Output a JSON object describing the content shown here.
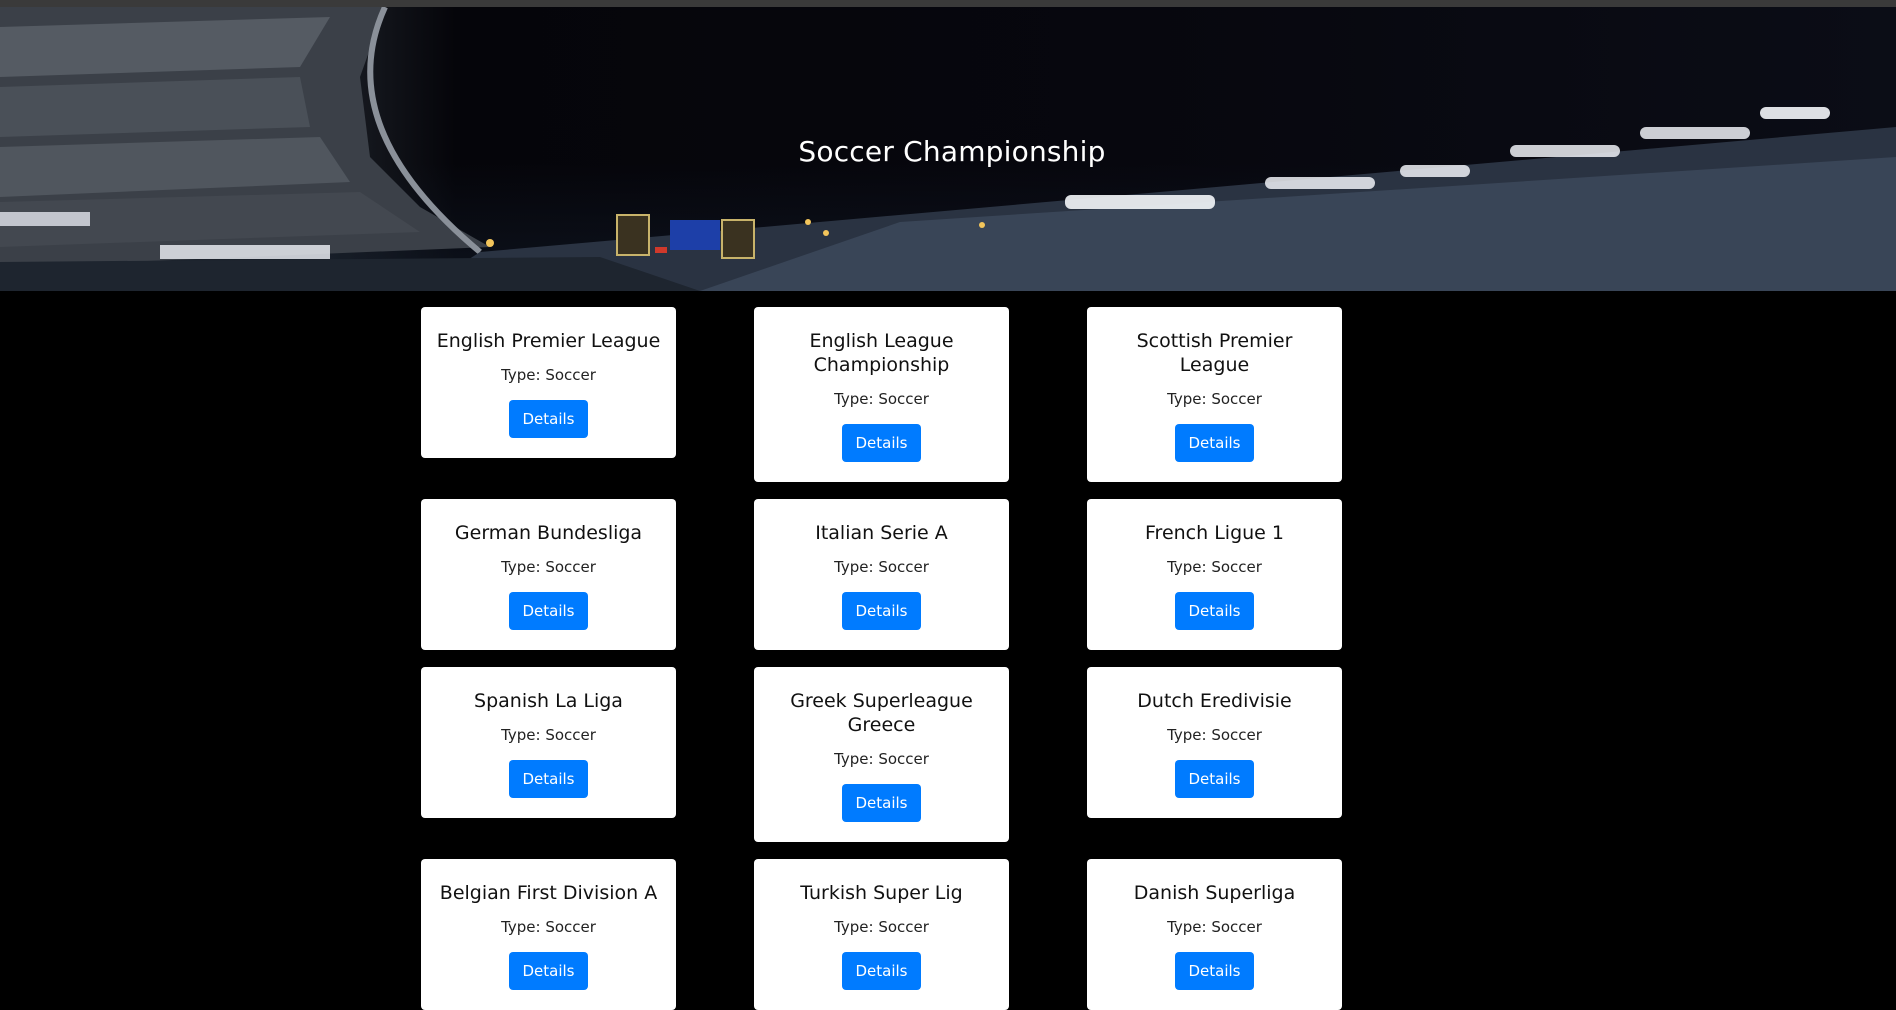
{
  "header": {
    "title": "Soccer Championship"
  },
  "type_prefix": "Type:",
  "leagues": [
    {
      "name": "English Premier League",
      "type": "Type: Soccer",
      "button": "Details"
    },
    {
      "name": "English League Championship",
      "type": "Type: Soccer",
      "button": "Details"
    },
    {
      "name": "Scottish Premier League",
      "type": "Type: Soccer",
      "button": "Details"
    },
    {
      "name": "German Bundesliga",
      "type": "Type: Soccer",
      "button": "Details"
    },
    {
      "name": "Italian Serie A",
      "type": "Type: Soccer",
      "button": "Details"
    },
    {
      "name": "French Ligue 1",
      "type": "Type: Soccer",
      "button": "Details"
    },
    {
      "name": "Spanish La Liga",
      "type": "Type: Soccer",
      "button": "Details"
    },
    {
      "name": "Greek Superleague Greece",
      "type": "Type: Soccer",
      "button": "Details"
    },
    {
      "name": "Dutch Eredivisie",
      "type": "Type: Soccer",
      "button": "Details"
    },
    {
      "name": "Belgian First Division A",
      "type": "Type: Soccer",
      "button": "Details"
    },
    {
      "name": "Turkish Super Lig",
      "type": "Type: Soccer",
      "button": "Details"
    },
    {
      "name": "Danish Superliga",
      "type": "Type: Soccer",
      "button": "Details"
    }
  ],
  "colors": {
    "background": "#000000",
    "card": "#ffffff",
    "button": "#007bff",
    "button_text": "#ffffff"
  }
}
